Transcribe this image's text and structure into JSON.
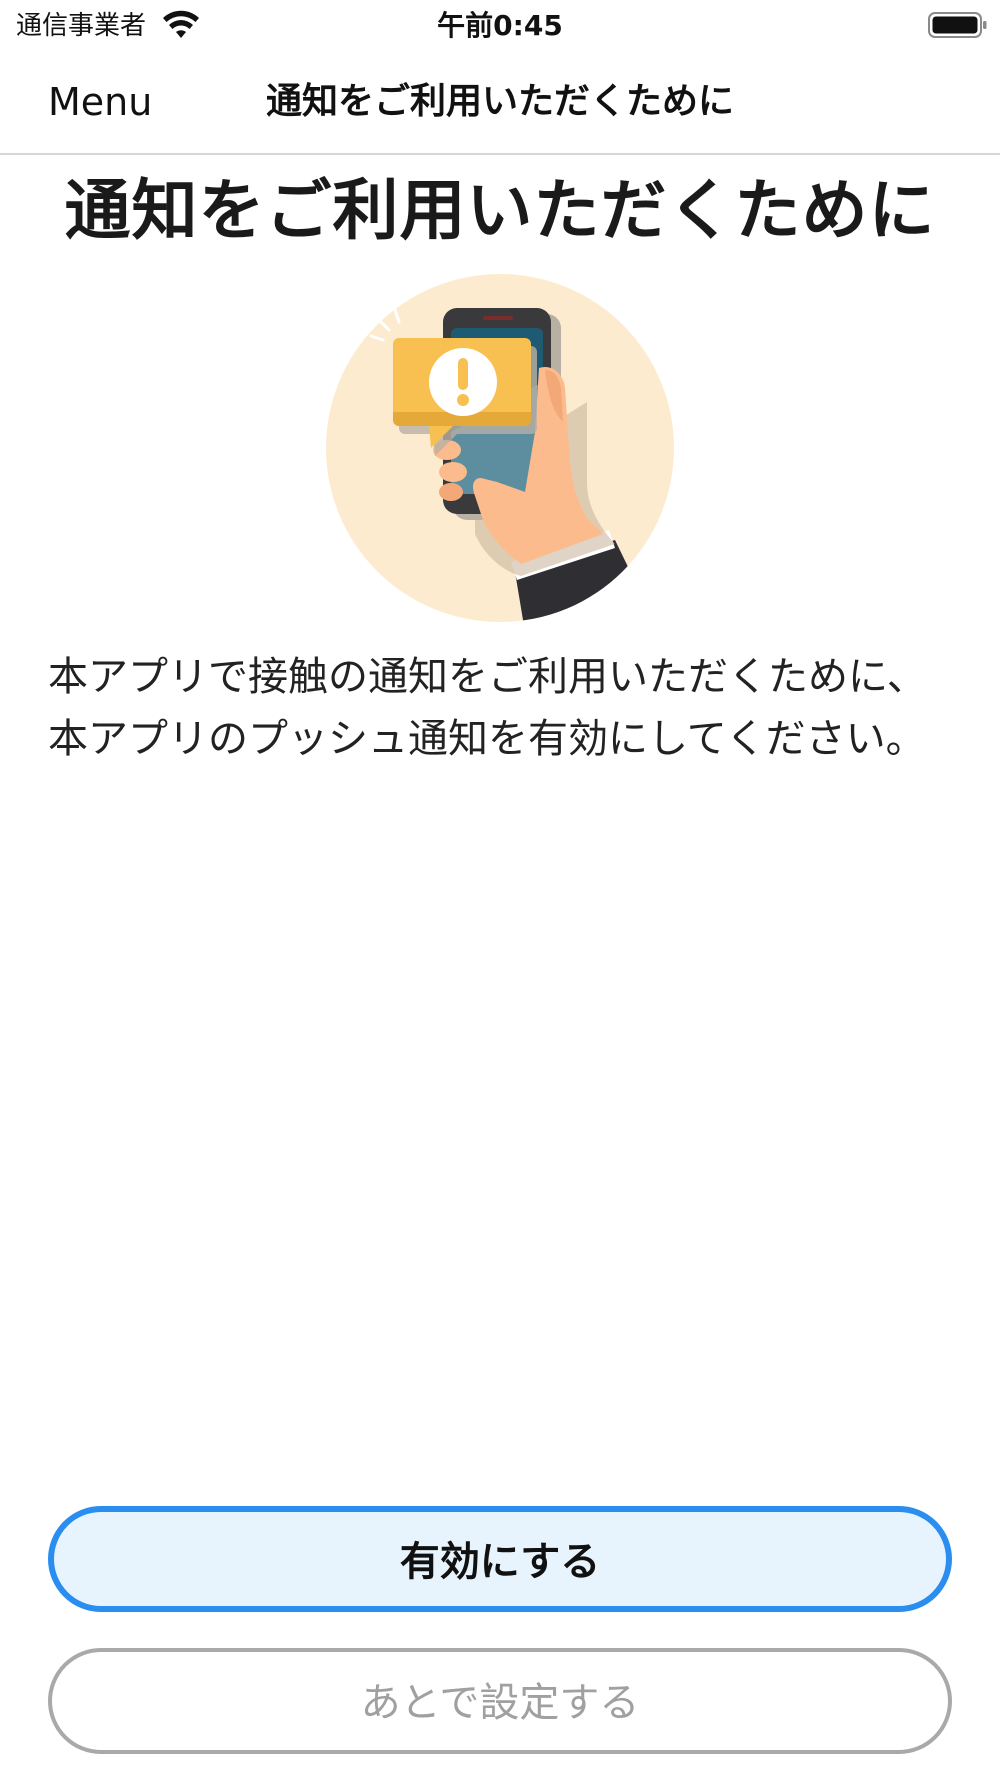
{
  "status_bar": {
    "carrier": "通信事業者",
    "time": "午前0:45",
    "wifi_icon": "wifi-icon",
    "battery_icon": "battery-icon"
  },
  "nav": {
    "back_label": "Menu",
    "title": "通知をご利用いただくために"
  },
  "main": {
    "heading": "通知をご利用いただくために",
    "illustration_icon": "phone-notification-alert-icon",
    "description_lines": [
      "本アプリで接触の通知をご利用いただくために、",
      "本アプリのプッシュ通知を有効にしてください。"
    ]
  },
  "actions": {
    "enable_label": "有効にする",
    "later_label": "あとで設定する"
  },
  "colors": {
    "accent": "#2a8ef0",
    "primary_button_bg": "#e8f4fd",
    "secondary_border": "#a9a9a9",
    "illustration_bg": "#fdebcf",
    "alert_yellow": "#f7c050"
  }
}
